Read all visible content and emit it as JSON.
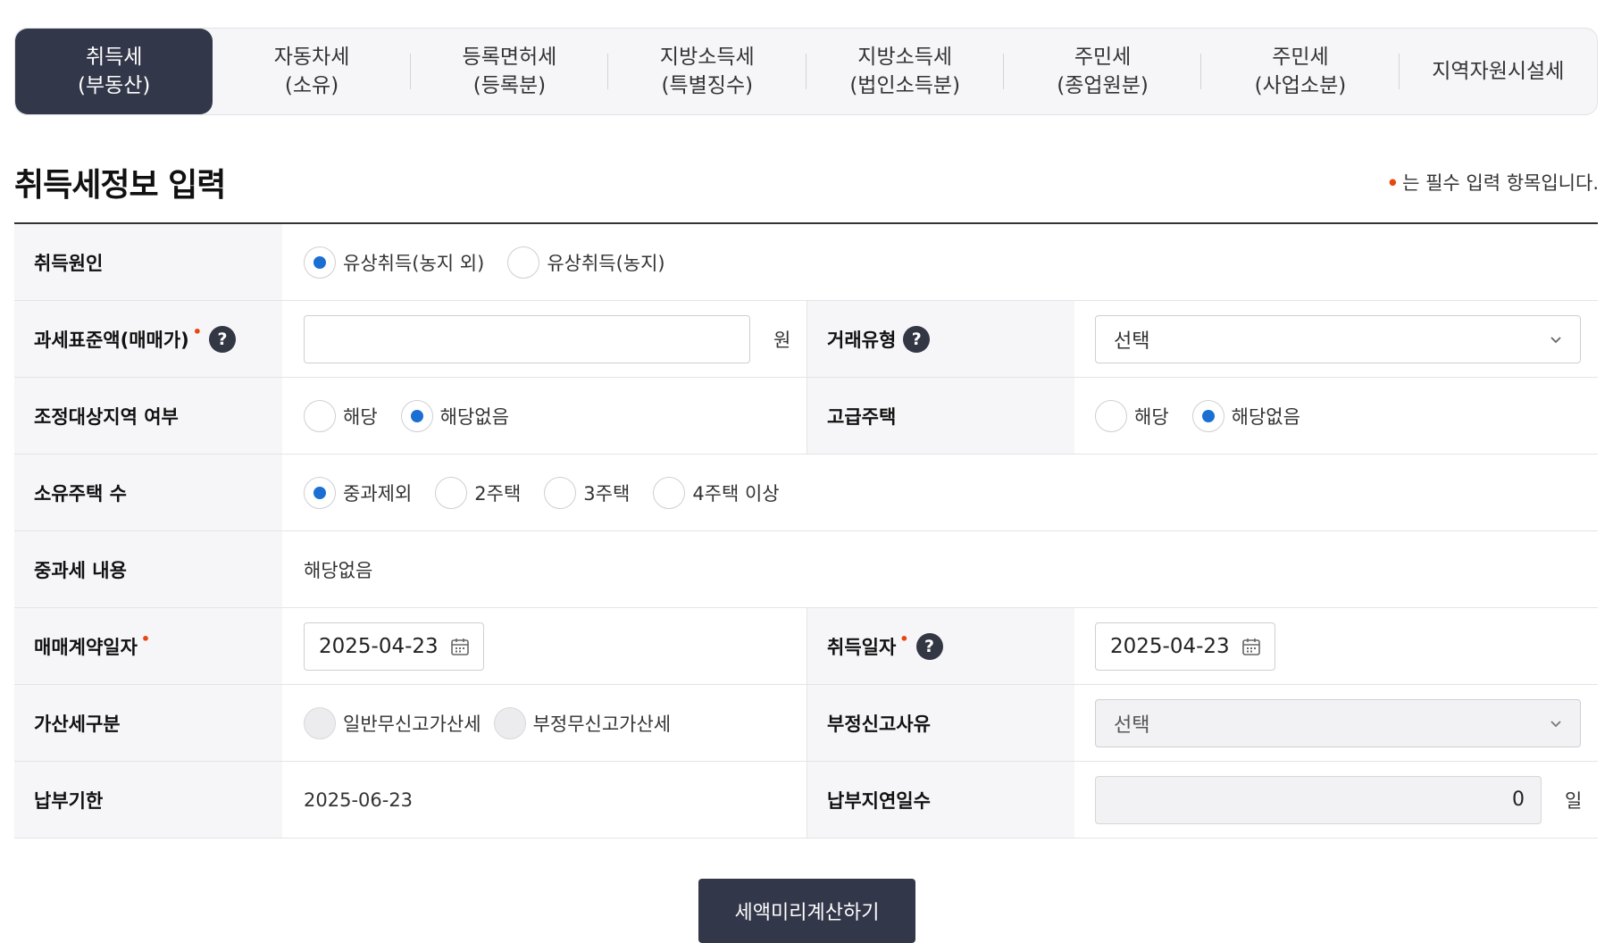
{
  "tabs": [
    {
      "label": "취득세\n(부동산)",
      "active": true
    },
    {
      "label": "자동차세\n(소유)"
    },
    {
      "label": "등록면허세\n(등록분)"
    },
    {
      "label": "지방소득세\n(특별징수)"
    },
    {
      "label": "지방소득세\n(법인소득분)"
    },
    {
      "label": "주민세\n(종업원분)"
    },
    {
      "label": "주민세\n(사업소분)"
    },
    {
      "label": "지역자원시설세"
    }
  ],
  "section": {
    "title": "취득세정보 입력",
    "required_note": "는 필수 입력 항목입니다.",
    "required_mark": "•"
  },
  "form": {
    "acquisition_cause": {
      "label": "취득원인",
      "options": [
        "유상취득(농지 외)",
        "유상취득(농지)"
      ],
      "selected": "유상취득(농지 외)"
    },
    "tax_base": {
      "label": "과세표준액(매매가)",
      "value": "",
      "unit": "원",
      "required": true,
      "help": "?"
    },
    "trade_type": {
      "label": "거래유형",
      "selected": "선택",
      "help": "?"
    },
    "adjusted_area": {
      "label": "조정대상지역 여부",
      "options": [
        "해당",
        "해당없음"
      ],
      "selected": "해당없음"
    },
    "luxury_house": {
      "label": "고급주택",
      "options": [
        "해당",
        "해당없음"
      ],
      "selected": "해당없음"
    },
    "house_count": {
      "label": "소유주택 수",
      "options": [
        "중과제외",
        "2주택",
        "3주택",
        "4주택 이상"
      ],
      "selected": "중과제외"
    },
    "heavy_tax": {
      "label": "중과세 내용",
      "value": "해당없음"
    },
    "contract_date": {
      "label": "매매계약일자",
      "value": "2025-04-23",
      "required": true
    },
    "acquisition_date": {
      "label": "취득일자",
      "value": "2025-04-23",
      "required": true,
      "help": "?"
    },
    "penalty_type": {
      "label": "가산세구분",
      "options": [
        "일반무신고가산세",
        "부정무신고가산세"
      ]
    },
    "fraud_reason": {
      "label": "부정신고사유",
      "selected": "선택"
    },
    "due_date": {
      "label": "납부기한",
      "value": "2025-06-23"
    },
    "delay_days": {
      "label": "납부지연일수",
      "value": "0",
      "unit": "일"
    }
  },
  "submit_label": "세액미리계산하기",
  "colors": {
    "accent": "#1b6fd3",
    "dark": "#33374a",
    "required": "#e8470f"
  }
}
